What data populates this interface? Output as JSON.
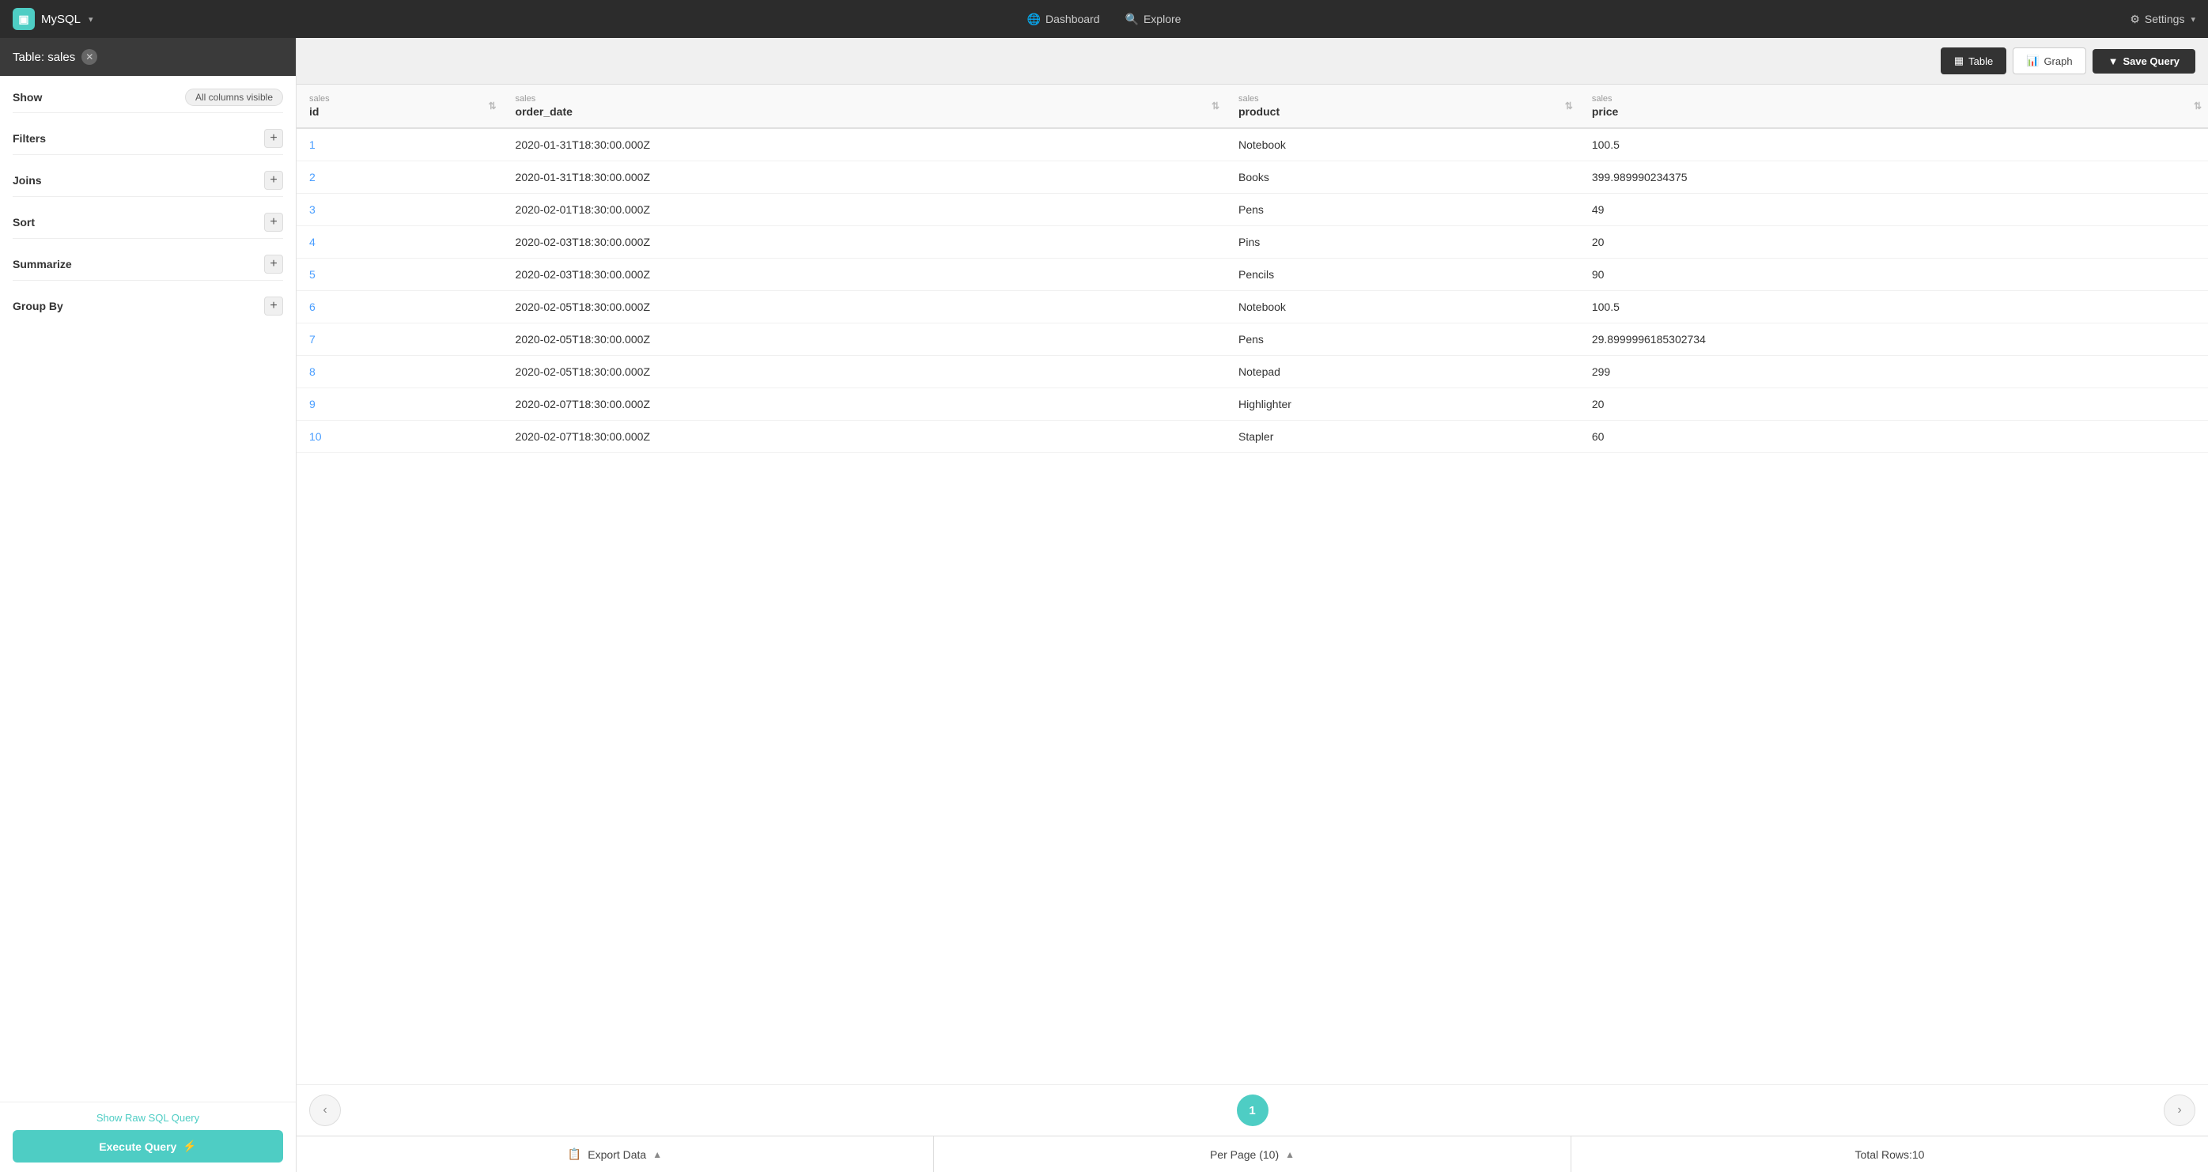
{
  "app": {
    "brand_icon": "▣",
    "db_label": "MySQL",
    "db_chevron": "▾"
  },
  "nav": {
    "dashboard_label": "Dashboard",
    "explore_label": "Explore",
    "settings_label": "Settings"
  },
  "sidebar": {
    "title": "Table: sales",
    "show_label": "Show",
    "show_value": "All columns visible",
    "filters_label": "Filters",
    "joins_label": "Joins",
    "sort_label": "Sort",
    "summarize_label": "Summarize",
    "group_by_label": "Group By",
    "show_sql_label": "Show Raw SQL Query",
    "execute_label": "Execute Query",
    "execute_icon": "⚡"
  },
  "toolbar": {
    "table_label": "Table",
    "graph_label": "Graph",
    "save_query_label": "Save Query",
    "filter_icon": "▼"
  },
  "table": {
    "columns": [
      {
        "schema": "sales",
        "name": "id"
      },
      {
        "schema": "sales",
        "name": "order_date"
      },
      {
        "schema": "sales",
        "name": "product"
      },
      {
        "schema": "sales",
        "name": "price"
      }
    ],
    "rows": [
      {
        "id": "1",
        "order_date": "2020-01-31T18:30:00.000Z",
        "product": "Notebook",
        "price": "100.5"
      },
      {
        "id": "2",
        "order_date": "2020-01-31T18:30:00.000Z",
        "product": "Books",
        "price": "399.989990234375"
      },
      {
        "id": "3",
        "order_date": "2020-02-01T18:30:00.000Z",
        "product": "Pens",
        "price": "49"
      },
      {
        "id": "4",
        "order_date": "2020-02-03T18:30:00.000Z",
        "product": "Pins",
        "price": "20"
      },
      {
        "id": "5",
        "order_date": "2020-02-03T18:30:00.000Z",
        "product": "Pencils",
        "price": "90"
      },
      {
        "id": "6",
        "order_date": "2020-02-05T18:30:00.000Z",
        "product": "Notebook",
        "price": "100.5"
      },
      {
        "id": "7",
        "order_date": "2020-02-05T18:30:00.000Z",
        "product": "Pens",
        "price": "29.8999996185302734"
      },
      {
        "id": "8",
        "order_date": "2020-02-05T18:30:00.000Z",
        "product": "Notepad",
        "price": "299"
      },
      {
        "id": "9",
        "order_date": "2020-02-07T18:30:00.000Z",
        "product": "Highlighter",
        "price": "20"
      },
      {
        "id": "10",
        "order_date": "2020-02-07T18:30:00.000Z",
        "product": "Stapler",
        "price": "60"
      }
    ]
  },
  "pagination": {
    "current_page": "1",
    "prev_icon": "‹",
    "next_icon": "›"
  },
  "bottom_bar": {
    "export_label": "Export Data",
    "export_icon": "📋",
    "per_page_label": "Per Page (10)",
    "total_label": "Total Rows:10"
  }
}
